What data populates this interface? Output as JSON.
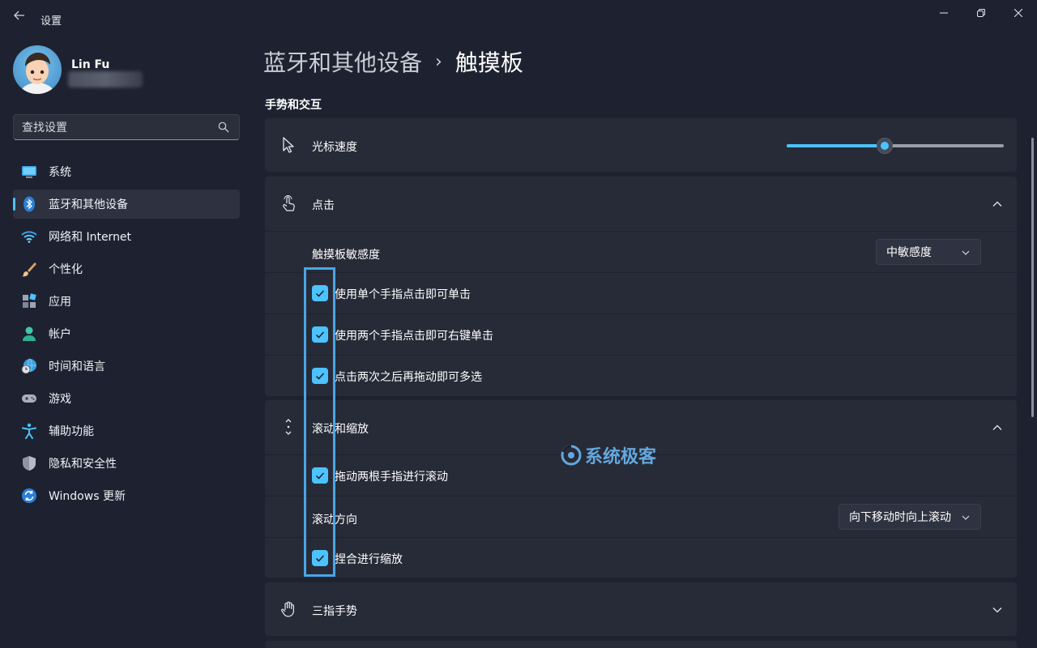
{
  "window": {
    "title": "设置"
  },
  "user": {
    "name": "Lin Fu"
  },
  "search": {
    "placeholder": "查找设置"
  },
  "sidebar": {
    "items": [
      {
        "label": "系统",
        "icon": "monitor-icon",
        "active": false
      },
      {
        "label": "蓝牙和其他设备",
        "icon": "bluetooth-icon",
        "active": true
      },
      {
        "label": "网络和 Internet",
        "icon": "wifi-icon",
        "active": false
      },
      {
        "label": "个性化",
        "icon": "brush-icon",
        "active": false
      },
      {
        "label": "应用",
        "icon": "apps-icon",
        "active": false
      },
      {
        "label": "帐户",
        "icon": "person-icon",
        "active": false
      },
      {
        "label": "时间和语言",
        "icon": "globe-clock-icon",
        "active": false
      },
      {
        "label": "游戏",
        "icon": "gamepad-icon",
        "active": false
      },
      {
        "label": "辅助功能",
        "icon": "accessibility-icon",
        "active": false
      },
      {
        "label": "隐私和安全性",
        "icon": "shield-icon",
        "active": false
      },
      {
        "label": "Windows 更新",
        "icon": "sync-icon",
        "active": false
      }
    ]
  },
  "breadcrumb": {
    "parent": "蓝牙和其他设备",
    "separator": "›",
    "current": "触摸板"
  },
  "main": {
    "section_title": "手势和交互",
    "cursor_speed": {
      "label": "光标速度",
      "value_fraction": 0.45
    },
    "tap": {
      "label": "点击",
      "sensitivity_label": "触摸板敏感度",
      "sensitivity_value": "中敏感度",
      "options": [
        {
          "label": "使用单个手指点击即可单击",
          "checked": true
        },
        {
          "label": "使用两个手指点击即可右键单击",
          "checked": true
        },
        {
          "label": "点击两次之后再拖动即可多选",
          "checked": true
        }
      ]
    },
    "scroll_zoom": {
      "label": "滚动和缩放",
      "drag_scroll_label": "拖动两根手指进行滚动",
      "drag_scroll_checked": true,
      "direction_label": "滚动方向",
      "direction_value": "向下移动时向上滚动",
      "pinch_label": "捏合进行缩放",
      "pinch_checked": true
    },
    "three_finger": {
      "label": "三指手势"
    }
  },
  "watermark": {
    "text": "系统极客"
  },
  "colors": {
    "accent": "#4cc2ff",
    "background": "#1e2230",
    "card": "#272b38",
    "highlight": "#4aa6e6"
  }
}
